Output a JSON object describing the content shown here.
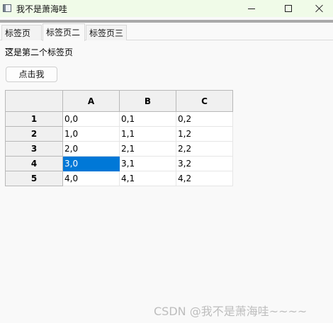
{
  "window": {
    "title": "我不是萧海哇",
    "buttons": {
      "minimize_icon": "minimize-icon",
      "maximize_icon": "maximize-icon",
      "close_icon": "close-icon"
    }
  },
  "tabs": [
    {
      "label": "标签页一"
    },
    {
      "label": "标签页二",
      "active": true
    },
    {
      "label": "标签页三"
    }
  ],
  "content": {
    "description": "这是第二个标签页",
    "button_label": "点击我"
  },
  "table": {
    "columns": [
      "A",
      "B",
      "C"
    ],
    "rows": [
      {
        "header": "1",
        "cells": [
          "0,0",
          "0,1",
          "0,2"
        ]
      },
      {
        "header": "2",
        "cells": [
          "1,0",
          "1,1",
          "1,2"
        ]
      },
      {
        "header": "3",
        "cells": [
          "2,0",
          "2,1",
          "2,2"
        ]
      },
      {
        "header": "4",
        "cells": [
          "3,0",
          "3,1",
          "3,2"
        ]
      },
      {
        "header": "5",
        "cells": [
          "4,0",
          "4,1",
          "4,2"
        ]
      }
    ],
    "selected_cell": {
      "row": 4,
      "column": "A"
    },
    "selection_color": "#0078d7"
  },
  "watermark": "CSDN @我不是萧海哇~~~~"
}
